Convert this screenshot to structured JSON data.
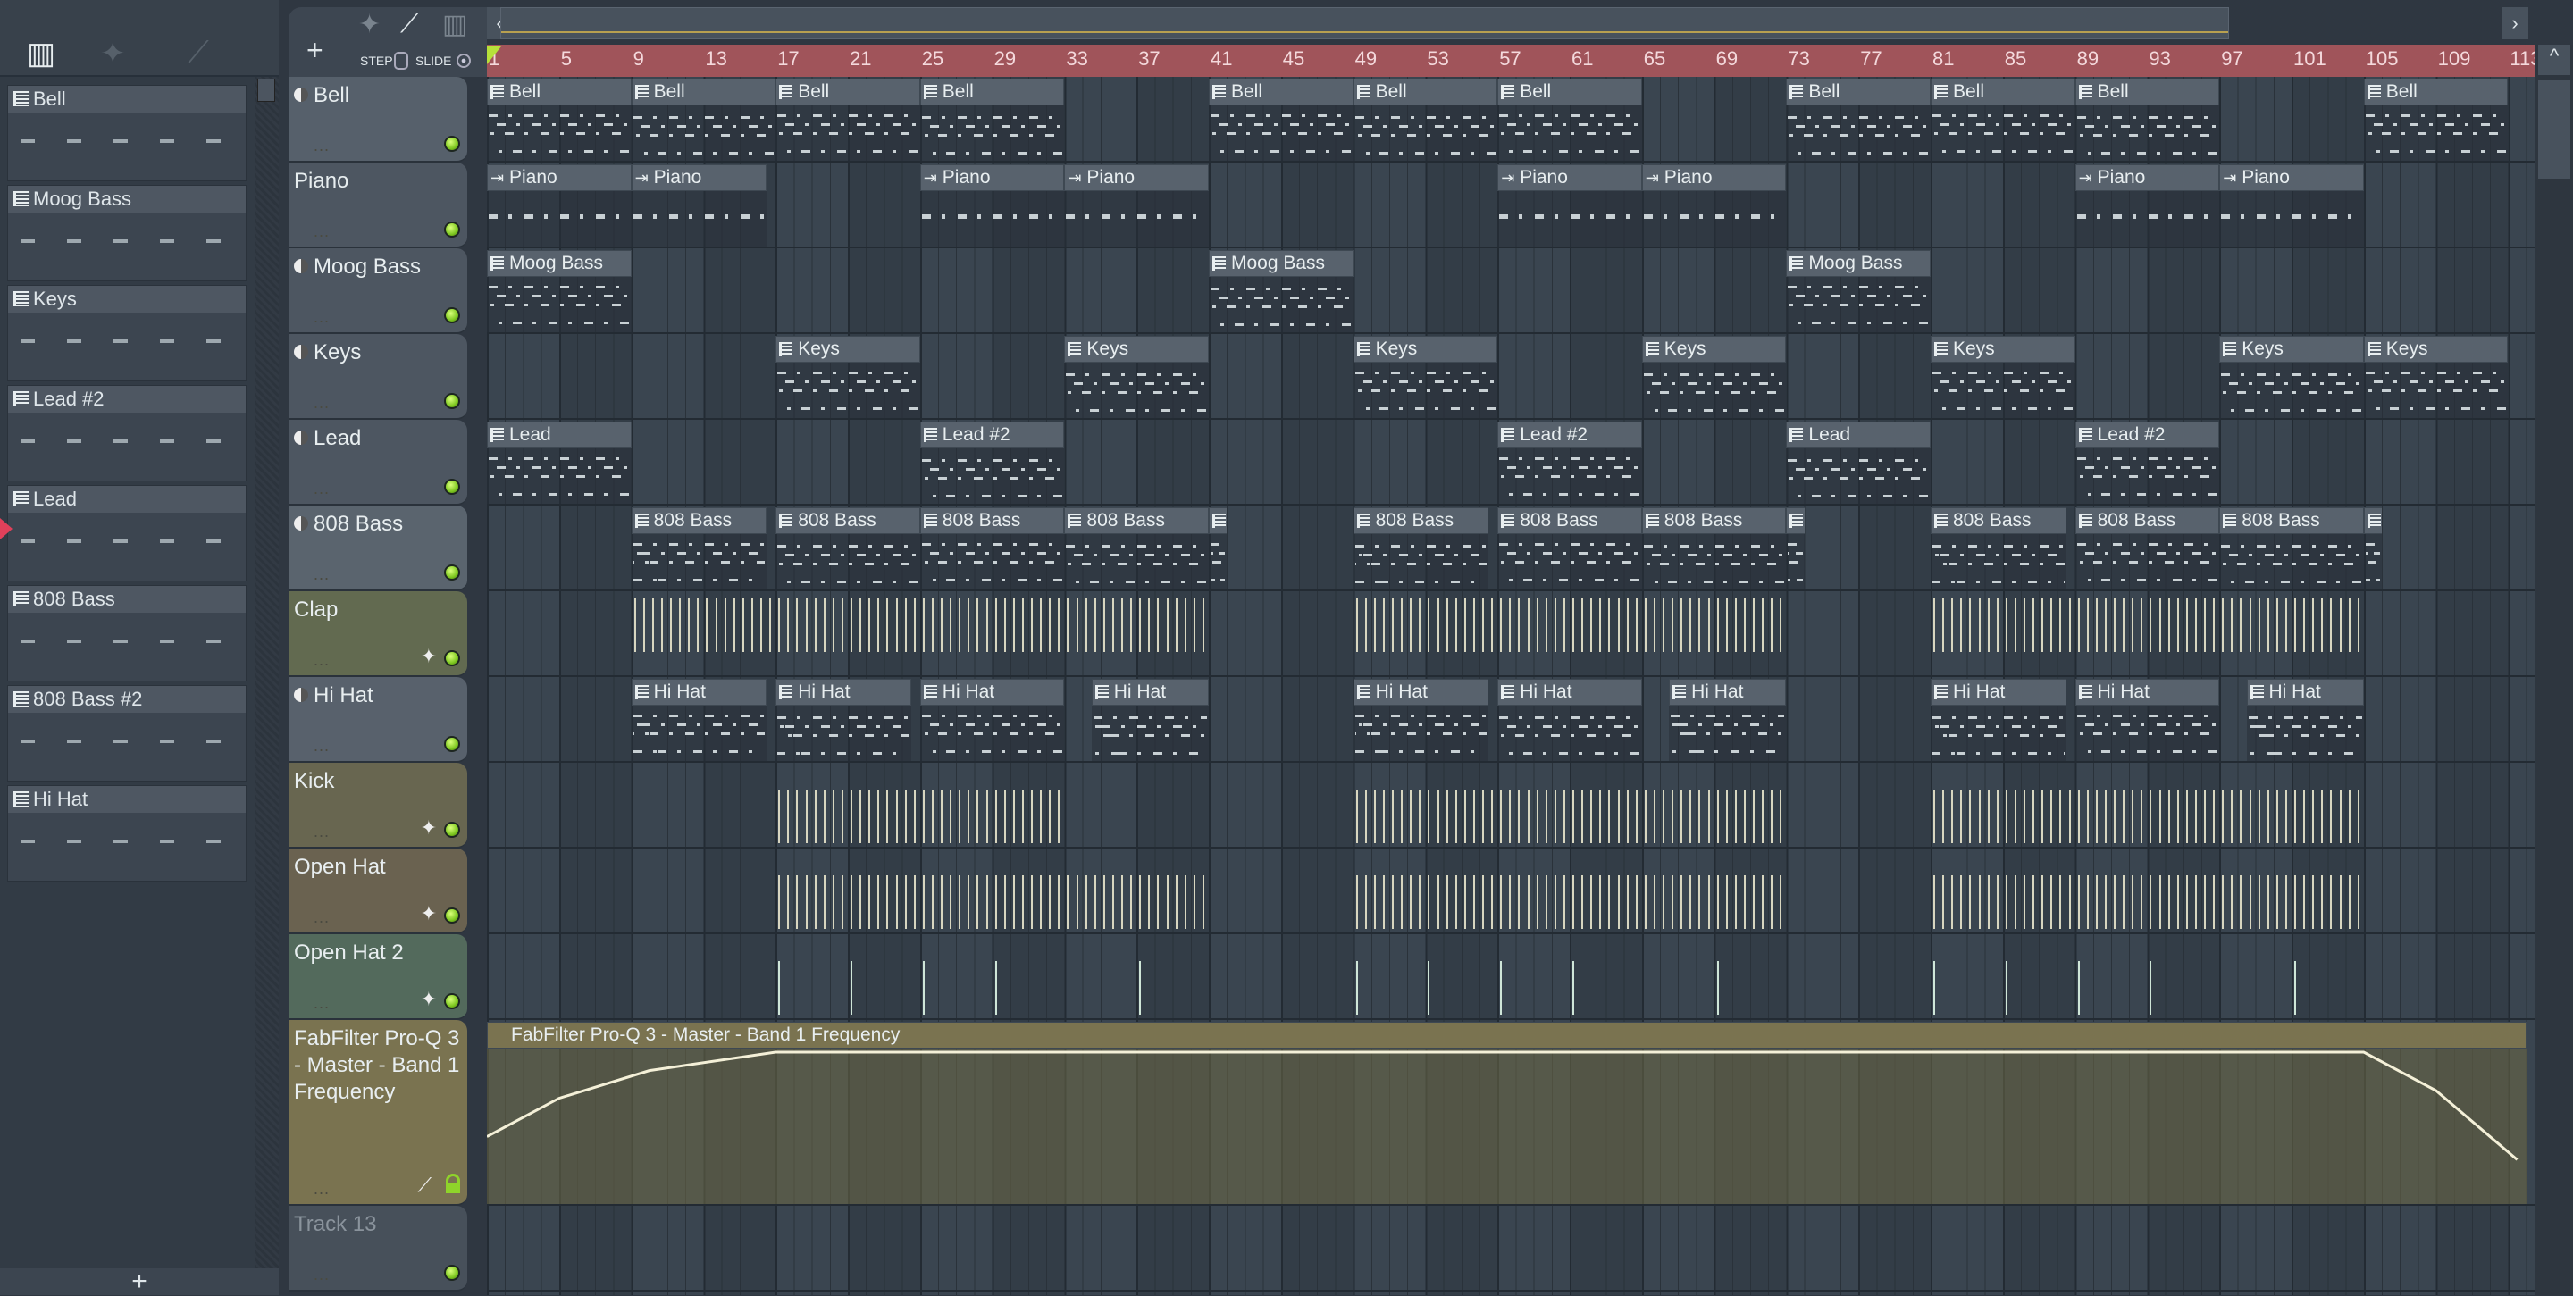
{
  "picker": {
    "tools": [
      "piano-roll",
      "audio",
      "automation"
    ],
    "items": [
      "Bell",
      "Moog Bass",
      "Keys",
      "Lead #2",
      "Lead",
      "808 Bass",
      "808 Bass #2",
      "Hi Hat"
    ],
    "add_label": "+"
  },
  "playlist_tools": {
    "add_label": "+",
    "step_label": "STEP",
    "slide_label": "SLIDE"
  },
  "ruler": {
    "bars": [
      "1",
      "5",
      "9",
      "13",
      "17",
      "21",
      "25",
      "29",
      "33",
      "37",
      "41",
      "45",
      "49",
      "53",
      "57",
      "61",
      "65",
      "69",
      "73",
      "77",
      "81",
      "85",
      "89",
      "93",
      "97",
      "101",
      "105",
      "109",
      "113"
    ]
  },
  "tracks": [
    {
      "name": "Bell",
      "info": true,
      "color": "#56606b",
      "clips": [
        [
          1,
          9,
          "Bell"
        ],
        [
          9,
          17,
          "Bell"
        ],
        [
          17,
          25,
          "Bell"
        ],
        [
          25,
          33,
          "Bell"
        ],
        [
          41,
          49,
          "Bell"
        ],
        [
          49,
          57,
          "Bell"
        ],
        [
          57,
          65,
          "Bell"
        ],
        [
          73,
          81,
          "Bell"
        ],
        [
          81,
          89,
          "Bell"
        ],
        [
          89,
          97,
          "Bell"
        ],
        [
          105,
          113,
          "Bell"
        ]
      ],
      "kind": "pat"
    },
    {
      "name": "Piano",
      "info": false,
      "color": "#4d5661",
      "clips": [
        [
          1,
          9,
          "Piano"
        ],
        [
          9,
          16.5,
          "Piano"
        ],
        [
          25,
          33,
          "Piano"
        ],
        [
          33,
          41,
          "Piano"
        ],
        [
          57,
          65,
          "Piano"
        ],
        [
          65,
          73,
          "Piano"
        ],
        [
          89,
          97,
          "Piano"
        ],
        [
          97,
          105,
          "Piano"
        ]
      ],
      "kind": "aud"
    },
    {
      "name": "Moog Bass",
      "info": true,
      "color": "#4d5661",
      "clips": [
        [
          1,
          9,
          "Moog Bass"
        ],
        [
          41,
          49,
          "Moog Bass"
        ],
        [
          73,
          81,
          "Moog Bass"
        ]
      ],
      "kind": "pat"
    },
    {
      "name": "Keys",
      "info": true,
      "color": "#4d5661",
      "clips": [
        [
          17,
          25,
          "Keys"
        ],
        [
          33,
          41,
          "Keys"
        ],
        [
          49,
          57,
          "Keys"
        ],
        [
          65,
          73,
          "Keys"
        ],
        [
          81,
          89,
          "Keys"
        ],
        [
          97,
          105,
          "Keys"
        ],
        [
          105,
          113,
          "Keys"
        ]
      ],
      "kind": "pat"
    },
    {
      "name": "Lead",
      "info": true,
      "color": "#4d5661",
      "clips": [
        [
          1,
          9,
          "Lead"
        ],
        [
          25,
          33,
          "Lead #2"
        ],
        [
          57,
          65,
          "Lead #2"
        ],
        [
          73,
          81,
          "Lead"
        ],
        [
          89,
          97,
          "Lead #2"
        ]
      ],
      "kind": "pat"
    },
    {
      "name": "808 Bass",
      "info": true,
      "color": "#5a646e",
      "clips": [
        [
          9,
          16.5,
          "808 Bass"
        ],
        [
          17,
          25,
          "808 Bass"
        ],
        [
          25,
          33,
          "808 Bass"
        ],
        [
          33,
          41,
          "808 Bass"
        ],
        [
          41,
          42,
          ""
        ],
        [
          49,
          56.5,
          "808 Bass"
        ],
        [
          57,
          65,
          "808 Bass"
        ],
        [
          65,
          73,
          "808 Bass"
        ],
        [
          73,
          74,
          ""
        ],
        [
          81,
          88.5,
          "808 Bass"
        ],
        [
          89,
          97,
          "808 Bass"
        ],
        [
          97,
          105,
          "808 Bass"
        ],
        [
          105,
          106,
          ""
        ]
      ],
      "kind": "pat"
    },
    {
      "name": "Clap",
      "info": false,
      "color": "#626a50",
      "hits": [
        [
          9,
          41
        ],
        [
          49,
          73
        ],
        [
          81,
          105
        ]
      ],
      "icon": "audio"
    },
    {
      "name": "Hi Hat",
      "info": true,
      "color": "#58616c",
      "clips": [
        [
          9,
          16.5,
          "Hi Hat"
        ],
        [
          17,
          24.5,
          "Hi Hat"
        ],
        [
          25,
          33,
          "Hi Hat"
        ],
        [
          34.5,
          41,
          "Hi Hat"
        ],
        [
          49,
          56.5,
          "Hi Hat"
        ],
        [
          57,
          65,
          "Hi Hat"
        ],
        [
          66.5,
          73,
          "Hi Hat"
        ],
        [
          81,
          88.5,
          "Hi Hat"
        ],
        [
          89,
          97,
          "Hi Hat"
        ],
        [
          98.5,
          105,
          "Hi Hat"
        ]
      ],
      "kind": "pat"
    },
    {
      "name": "Kick",
      "info": false,
      "color": "#686650",
      "hits": [
        [
          17,
          33
        ],
        [
          49,
          73
        ],
        [
          81,
          105
        ]
      ],
      "icon": "audio"
    },
    {
      "name": "Open Hat",
      "info": false,
      "color": "#6a6250",
      "hits": [
        [
          17,
          41
        ],
        [
          49,
          73
        ],
        [
          81,
          105
        ]
      ],
      "icon": "audio"
    },
    {
      "name": "Open Hat 2",
      "info": false,
      "color": "#536a5c",
      "hits": [
        [
          17,
          17.5
        ],
        [
          21,
          21.5
        ],
        [
          25,
          25.5
        ],
        [
          29,
          29.5
        ],
        [
          37,
          37.5
        ],
        [
          49,
          49.5
        ],
        [
          53,
          53.5
        ],
        [
          57,
          57.5
        ],
        [
          61,
          61.5
        ],
        [
          69,
          69.5
        ],
        [
          81,
          81.5
        ],
        [
          85,
          85.5
        ],
        [
          89,
          89.5
        ],
        [
          93,
          93.5
        ],
        [
          101,
          101.5
        ]
      ],
      "icon": "audio"
    },
    {
      "name": "FabFilter Pro-Q 3 - Master - Band 1 Frequency",
      "info": false,
      "color": "#7a7350",
      "automation": true,
      "clip_label": "FabFilter Pro-Q 3 - Master - Band 1 Frequency",
      "points": [
        [
          1,
          0.45
        ],
        [
          5,
          0.7
        ],
        [
          10,
          0.88
        ],
        [
          17,
          1
        ],
        [
          105,
          1
        ],
        [
          109,
          0.75
        ],
        [
          113.5,
          0.3
        ]
      ]
    },
    {
      "name": "Track 13",
      "info": false,
      "color": "#47505a",
      "dim": true
    }
  ]
}
